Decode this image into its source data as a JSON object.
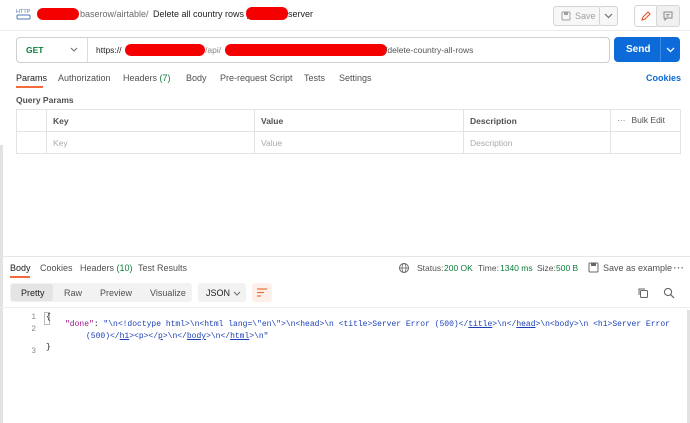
{
  "header": {
    "collection_icon": "http-request-icon",
    "path_fragment": "baserow/airtable",
    "separator": "/",
    "request_name_prefix": "Delete all country rows |",
    "request_name_suffix": "server",
    "save_label": "Save",
    "edit_icon": "pencil-icon",
    "comments_icon": "comment-icon"
  },
  "request": {
    "method": "GET",
    "url_prefix": "https://",
    "url_mid": "/api/",
    "url_suffix": "/delete-country-all-rows",
    "send_label": "Send"
  },
  "request_tabs": {
    "items": [
      "Params",
      "Authorization",
      "Headers",
      "Body",
      "Pre-request Script",
      "Tests",
      "Settings"
    ],
    "headers_count": "(7)",
    "active": "Params",
    "cookies_label": "Cookies"
  },
  "query_params": {
    "title": "Query Params",
    "columns": [
      "Key",
      "Value",
      "Description"
    ],
    "bulk_edit_label": "Bulk Edit",
    "placeholders": {
      "key": "Key",
      "value": "Value",
      "description": "Description"
    }
  },
  "response_tabs": {
    "body": "Body",
    "cookies": "Cookies",
    "headers": "Headers",
    "headers_count": "(10)",
    "test_results": "Test Results"
  },
  "response_meta": {
    "status_label": "Status:",
    "status_value": "200 OK",
    "time_label": "Time:",
    "time_value": "1340 ms",
    "size_label": "Size:",
    "size_value": "500 B",
    "save_example_label": "Save as example",
    "status_color": "#0a7d3a"
  },
  "view_modes": {
    "items": [
      "Pretty",
      "Raw",
      "Preview",
      "Visualize"
    ],
    "active": "Pretty",
    "format": "JSON"
  },
  "response_body": {
    "line_numbers": [
      "1",
      "2",
      "3"
    ],
    "open_brace": "{",
    "close_brace": "}",
    "key": "\"done\"",
    "colon": ": ",
    "v1": "\"\\n<!doctype html>\\n<html lang=\\\"en\\\">\\n<head>\\n  <title>Server Error (500)</",
    "v1_tag1": "title",
    "v1b": ">\\n</",
    "v1_tag2": "head",
    "v1c": ">\\n<body>\\n  <h1>Server Error",
    "v2a": "(500)</",
    "v2_tag1": "h1",
    "v2b": "><p></",
    "v2_tag2": "p",
    "v2c": ">\\n</",
    "v2_tag3": "body",
    "v2d": ">\\n</",
    "v2_tag4": "html",
    "v2e": ">\\n\""
  }
}
